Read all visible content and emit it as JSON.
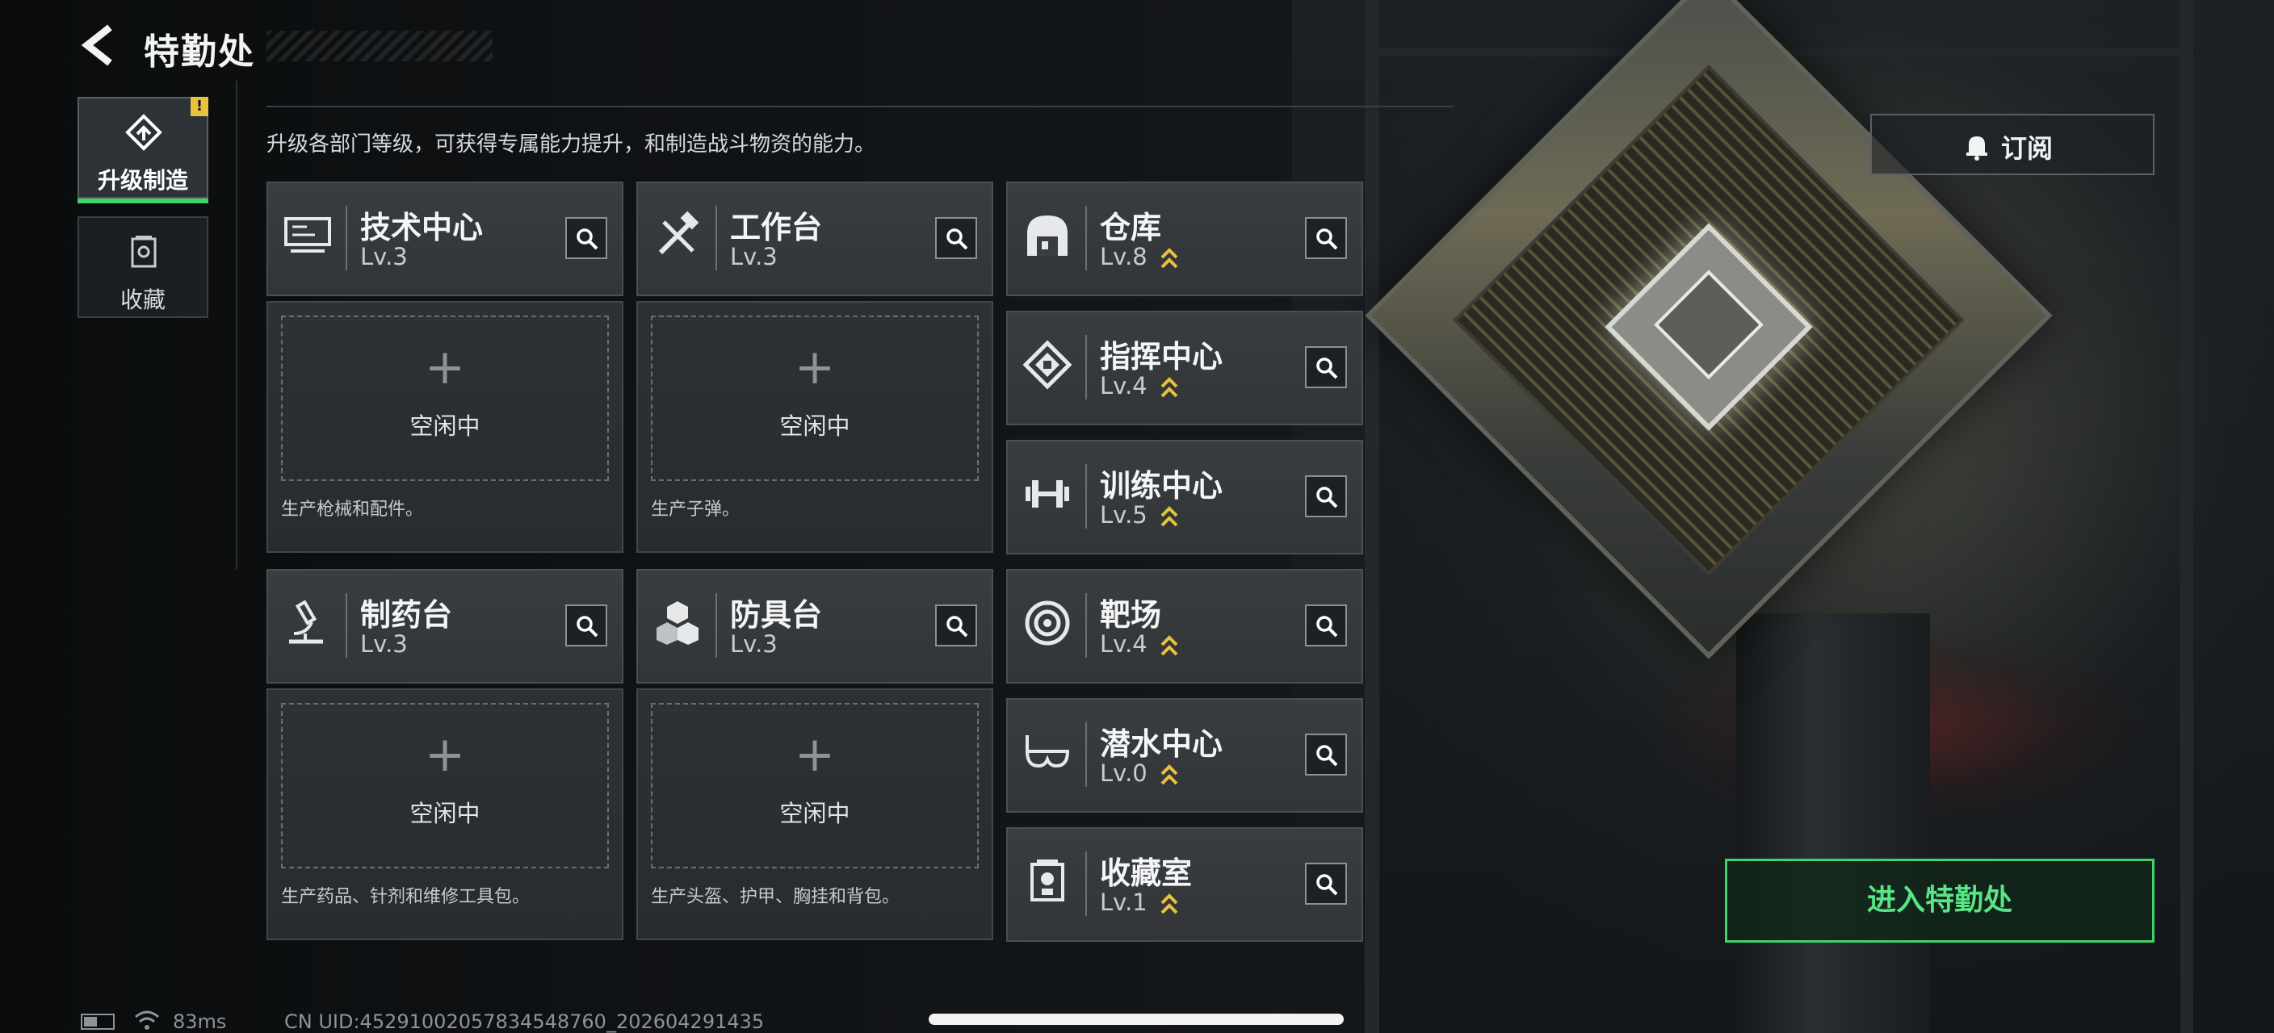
{
  "header": {
    "title": "特勤处"
  },
  "sidebar": {
    "items": [
      {
        "label": "升级制造",
        "active": true,
        "badge": "!"
      },
      {
        "label": "收藏",
        "active": false
      }
    ]
  },
  "description": "升级各部门等级，可获得专属能力提升，和制造战斗物资的能力。",
  "production_cards": [
    {
      "name": "技术中心",
      "level": "Lv.3",
      "icon": "monitor-icon",
      "slot_status": "空闲中",
      "slot_plus": "+",
      "produces": "生产枪械和配件。"
    },
    {
      "name": "工作台",
      "level": "Lv.3",
      "icon": "tools-icon",
      "slot_status": "空闲中",
      "slot_plus": "+",
      "produces": "生产子弹。"
    },
    {
      "name": "制药台",
      "level": "Lv.3",
      "icon": "microscope-icon",
      "slot_status": "空闲中",
      "slot_plus": "+",
      "produces": "生产药品、针剂和维修工具包。"
    },
    {
      "name": "防具台",
      "level": "Lv.3",
      "icon": "armor-blocks-icon",
      "slot_status": "空闲中",
      "slot_plus": "+",
      "produces": "生产头盔、护甲、胸挂和背包。"
    }
  ],
  "facilities": [
    {
      "name": "仓库",
      "level": "Lv.8",
      "icon": "warehouse-icon",
      "upgradable": true
    },
    {
      "name": "指挥中心",
      "level": "Lv.4",
      "icon": "command-chip-icon",
      "upgradable": true
    },
    {
      "name": "训练中心",
      "level": "Lv.5",
      "icon": "dumbbell-icon",
      "upgradable": true
    },
    {
      "name": "靶场",
      "level": "Lv.4",
      "icon": "target-icon",
      "upgradable": true
    },
    {
      "name": "潜水中心",
      "level": "Lv.0",
      "icon": "diving-mask-icon",
      "upgradable": true
    },
    {
      "name": "收藏室",
      "level": "Lv.1",
      "icon": "trophy-case-icon",
      "upgradable": true
    }
  ],
  "subscribe": {
    "label": "订阅",
    "icon": "bell-icon"
  },
  "enter_button": {
    "label": "进入特勤处"
  },
  "status_bar": {
    "ping": "83ms",
    "uid": "CN UID:45291002057834548760_202604291435"
  },
  "colors": {
    "accent_green": "#3fd46b",
    "upgrade_gold": "#e8c23a",
    "card_bg": "#3a3d40"
  }
}
